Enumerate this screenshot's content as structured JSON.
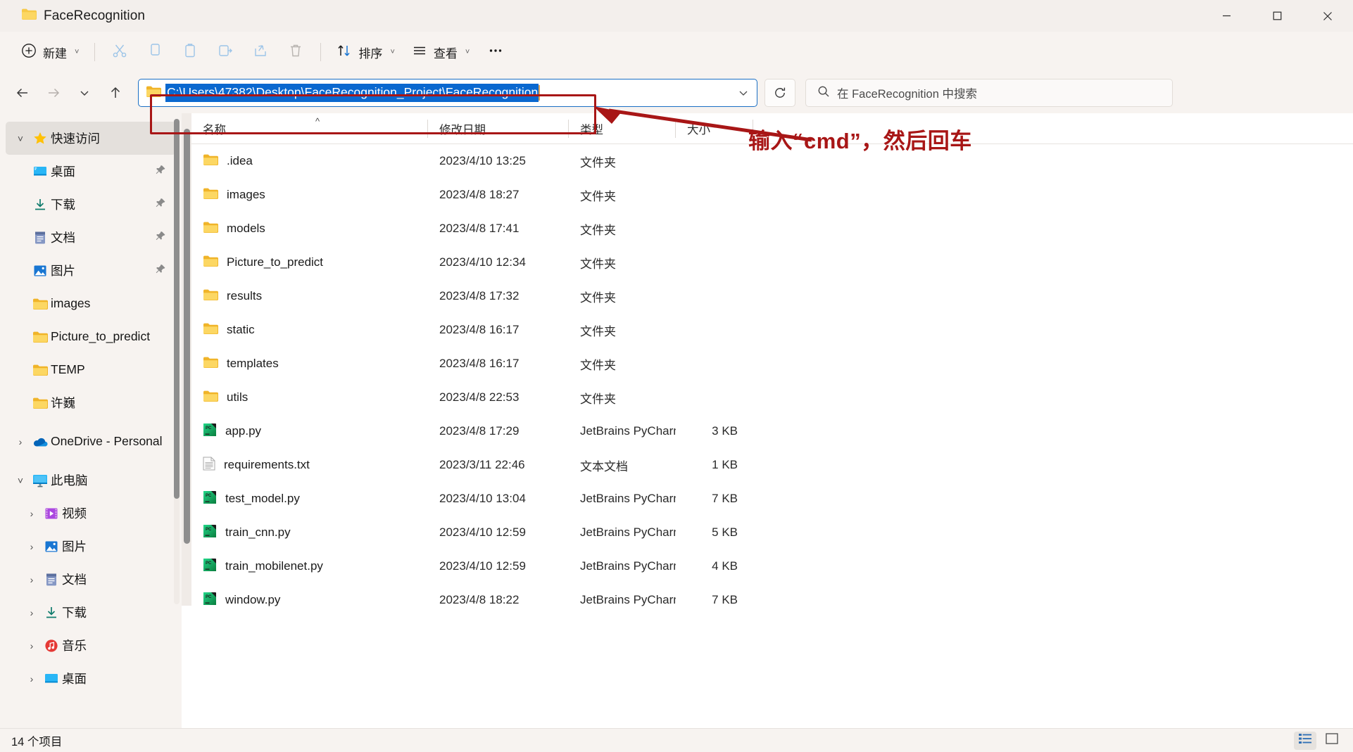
{
  "window": {
    "tab_title": "FaceRecognition",
    "minimize_label": "最小化",
    "maximize_label": "最大化",
    "close_label": "关闭"
  },
  "toolbar": {
    "new_label": "新建",
    "cut_label": "剪切",
    "copy_label": "复制",
    "paste_label": "粘贴",
    "rename_label": "重命名",
    "share_label": "共享",
    "delete_label": "删除",
    "sort_label": "排序",
    "view_label": "查看",
    "more_label": "查看更多"
  },
  "nav": {
    "back_label": "后退",
    "forward_label": "前进",
    "recent_label": "最近的位置",
    "up_label": "向上",
    "address_value": "C:\\Users\\47382\\Desktop\\FaceRecognition_Project\\FaceRecognition",
    "refresh_label": "刷新",
    "search_placeholder": "在 FaceRecognition 中搜索"
  },
  "annotation": {
    "note_text": "输入“cmd”，然后回车",
    "color": "#a81616"
  },
  "sidebar": {
    "items": [
      {
        "label": "快速访问",
        "icon": "star-icon",
        "twisty": "expanded",
        "level": 0,
        "selected": true,
        "pinned": false
      },
      {
        "label": "桌面",
        "icon": "desktop-icon",
        "twisty": "none",
        "level": 1,
        "selected": false,
        "pinned": true
      },
      {
        "label": "下载",
        "icon": "downloads-icon",
        "twisty": "none",
        "level": 1,
        "selected": false,
        "pinned": true
      },
      {
        "label": "文档",
        "icon": "documents-icon",
        "twisty": "none",
        "level": 1,
        "selected": false,
        "pinned": true
      },
      {
        "label": "图片",
        "icon": "pictures-icon",
        "twisty": "none",
        "level": 1,
        "selected": false,
        "pinned": true
      },
      {
        "label": "images",
        "icon": "folder-icon",
        "twisty": "none",
        "level": 1,
        "selected": false,
        "pinned": false
      },
      {
        "label": "Picture_to_predict",
        "icon": "folder-icon",
        "twisty": "none",
        "level": 1,
        "selected": false,
        "pinned": false
      },
      {
        "label": "TEMP",
        "icon": "folder-icon",
        "twisty": "none",
        "level": 1,
        "selected": false,
        "pinned": false
      },
      {
        "label": "许巍",
        "icon": "folder-icon",
        "twisty": "none",
        "level": 1,
        "selected": false,
        "pinned": false
      },
      {
        "label": "OneDrive - Personal",
        "icon": "onedrive-icon",
        "twisty": "collapsed",
        "level": 0,
        "selected": false,
        "pinned": false
      },
      {
        "label": "此电脑",
        "icon": "thispc-icon",
        "twisty": "expanded",
        "level": 0,
        "selected": false,
        "pinned": false
      },
      {
        "label": "视频",
        "icon": "videos-icon",
        "twisty": "collapsed",
        "level": 1,
        "selected": false,
        "pinned": false
      },
      {
        "label": "图片",
        "icon": "pictures-icon",
        "twisty": "collapsed",
        "level": 1,
        "selected": false,
        "pinned": false
      },
      {
        "label": "文档",
        "icon": "documents-icon",
        "twisty": "collapsed",
        "level": 1,
        "selected": false,
        "pinned": false
      },
      {
        "label": "下载",
        "icon": "downloads-icon",
        "twisty": "collapsed",
        "level": 1,
        "selected": false,
        "pinned": false
      },
      {
        "label": "音乐",
        "icon": "music-icon",
        "twisty": "collapsed",
        "level": 1,
        "selected": false,
        "pinned": false
      },
      {
        "label": "桌面",
        "icon": "desktop-icon",
        "twisty": "collapsed",
        "level": 1,
        "selected": false,
        "pinned": false
      }
    ]
  },
  "filelist": {
    "columns": {
      "name": "名称",
      "date": "修改日期",
      "type": "类型",
      "size": "大小"
    },
    "sort_column": "名称",
    "sort_direction": "ascending",
    "rows": [
      {
        "name": ".idea",
        "date": "2023/4/10 13:25",
        "type": "文件夹",
        "size": "",
        "icon": "folder-icon"
      },
      {
        "name": "images",
        "date": "2023/4/8 18:27",
        "type": "文件夹",
        "size": "",
        "icon": "folder-icon"
      },
      {
        "name": "models",
        "date": "2023/4/8 17:41",
        "type": "文件夹",
        "size": "",
        "icon": "folder-icon"
      },
      {
        "name": "Picture_to_predict",
        "date": "2023/4/10 12:34",
        "type": "文件夹",
        "size": "",
        "icon": "folder-icon"
      },
      {
        "name": "results",
        "date": "2023/4/8 17:32",
        "type": "文件夹",
        "size": "",
        "icon": "folder-icon"
      },
      {
        "name": "static",
        "date": "2023/4/8 16:17",
        "type": "文件夹",
        "size": "",
        "icon": "folder-icon"
      },
      {
        "name": "templates",
        "date": "2023/4/8 16:17",
        "type": "文件夹",
        "size": "",
        "icon": "folder-icon"
      },
      {
        "name": "utils",
        "date": "2023/4/8 22:53",
        "type": "文件夹",
        "size": "",
        "icon": "folder-icon"
      },
      {
        "name": "app.py",
        "date": "2023/4/8 17:29",
        "type": "JetBrains PyCharm ...",
        "size": "3 KB",
        "icon": "pycharm-icon"
      },
      {
        "name": "requirements.txt",
        "date": "2023/3/11 22:46",
        "type": "文本文档",
        "size": "1 KB",
        "icon": "text-icon"
      },
      {
        "name": "test_model.py",
        "date": "2023/4/10 13:04",
        "type": "JetBrains PyCharm ...",
        "size": "7 KB",
        "icon": "pycharm-icon"
      },
      {
        "name": "train_cnn.py",
        "date": "2023/4/10 12:59",
        "type": "JetBrains PyCharm ...",
        "size": "5 KB",
        "icon": "pycharm-icon"
      },
      {
        "name": "train_mobilenet.py",
        "date": "2023/4/10 12:59",
        "type": "JetBrains PyCharm ...",
        "size": "4 KB",
        "icon": "pycharm-icon"
      },
      {
        "name": "window.py",
        "date": "2023/4/8 18:22",
        "type": "JetBrains PyCharm ...",
        "size": "7 KB",
        "icon": "pycharm-icon"
      }
    ]
  },
  "statusbar": {
    "item_count": "14 个项目",
    "details_view_label": "详细信息视图",
    "large_icons_view_label": "大图标视图"
  }
}
